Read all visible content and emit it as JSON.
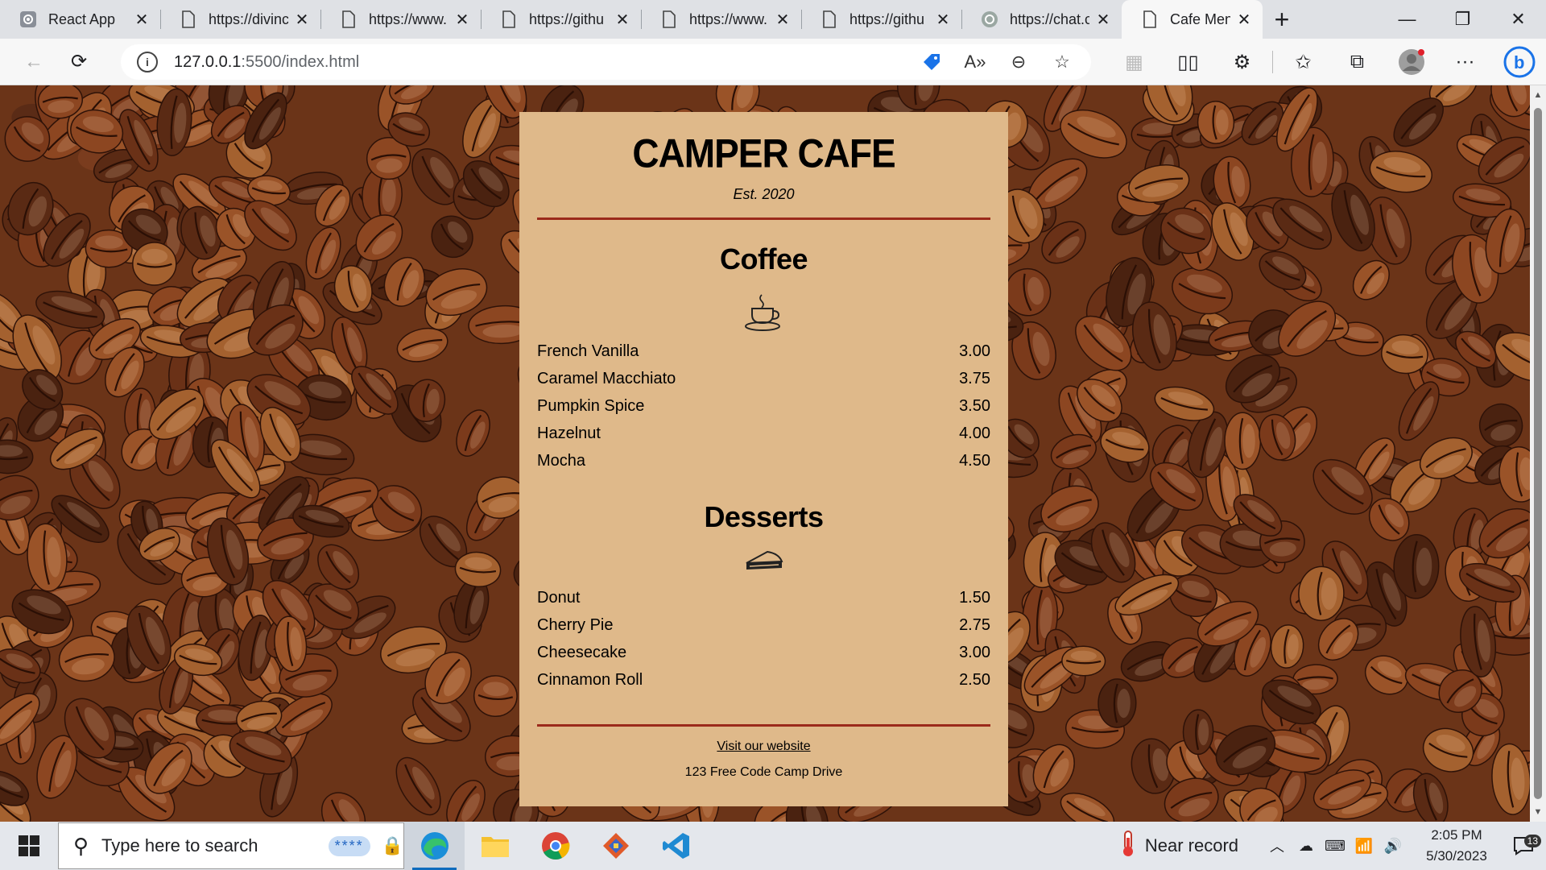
{
  "browser": {
    "tabs": [
      {
        "title": "React App",
        "icon": "react-gear-icon"
      },
      {
        "title": "https://divinc",
        "icon": "page-icon"
      },
      {
        "title": "https://www.",
        "icon": "page-icon"
      },
      {
        "title": "https://githu",
        "icon": "page-icon"
      },
      {
        "title": "https://www.",
        "icon": "page-icon"
      },
      {
        "title": "https://githu",
        "icon": "page-icon"
      },
      {
        "title": "https://chat.c",
        "icon": "chatgpt-icon"
      },
      {
        "title": "Cafe Menu",
        "icon": "page-icon",
        "active": true
      }
    ],
    "address": {
      "host": "127.0.0.1",
      "path": ":5500/index.html"
    }
  },
  "menu": {
    "title": "CAMPER CAFE",
    "established": "Est. 2020",
    "coffee": {
      "heading": "Coffee",
      "items": [
        {
          "name": "French Vanilla",
          "price": "3.00"
        },
        {
          "name": "Caramel Macchiato",
          "price": "3.75"
        },
        {
          "name": "Pumpkin Spice",
          "price": "3.50"
        },
        {
          "name": "Hazelnut",
          "price": "4.00"
        },
        {
          "name": "Mocha",
          "price": "4.50"
        }
      ]
    },
    "desserts": {
      "heading": "Desserts",
      "items": [
        {
          "name": "Donut",
          "price": "1.50"
        },
        {
          "name": "Cherry Pie",
          "price": "2.75"
        },
        {
          "name": "Cheesecake",
          "price": "3.00"
        },
        {
          "name": "Cinnamon Roll",
          "price": "2.50"
        }
      ]
    },
    "footer": {
      "link": "Visit our website",
      "address": "123 Free Code Camp Drive"
    }
  },
  "taskbar": {
    "search_placeholder": "Type here to search",
    "password_hint": "****",
    "weather": "Near record",
    "time": "2:05 PM",
    "date": "5/30/2023",
    "notification_count": "13"
  },
  "colors": {
    "menu_background": "#dfb98a",
    "rule": "#9b2a1b",
    "bean_background": "#6b3418"
  }
}
